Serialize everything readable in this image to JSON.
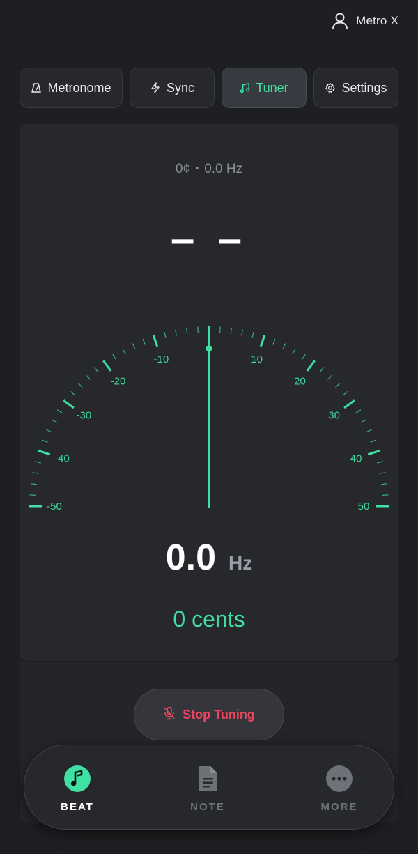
{
  "header": {
    "user_name": "Metro X",
    "user_icon": "person-icon"
  },
  "tabs": [
    {
      "label": "Metronome",
      "icon": "metronome-icon",
      "active": false
    },
    {
      "label": "Sync",
      "icon": "lightning-icon",
      "active": false
    },
    {
      "label": "Tuner",
      "icon": "music-note-icon",
      "active": true
    },
    {
      "label": "Settings",
      "icon": "gear-icon",
      "active": false
    }
  ],
  "tuner": {
    "cents_small": "0¢",
    "separator": "•",
    "hz_small": "0.0 Hz",
    "note": "– –",
    "frequency": "0.0",
    "frequency_unit": "Hz",
    "cents_label": "0 cents",
    "cents_value": 0,
    "gauge": {
      "min": -50,
      "max": 50,
      "labels": [
        "-50",
        "-40",
        "-30",
        "-20",
        "-10",
        "10",
        "20",
        "30",
        "40",
        "50"
      ]
    }
  },
  "stop_button": {
    "label": "Stop Tuning",
    "icon": "mic-off-icon"
  },
  "bottom_nav": [
    {
      "label": "BEAT",
      "icon": "music-note-circle-icon",
      "active": true
    },
    {
      "label": "NOTE",
      "icon": "document-icon",
      "active": false
    },
    {
      "label": "MORE",
      "icon": "more-dots-icon",
      "active": false
    }
  ],
  "colors": {
    "accent": "#3fe0a4",
    "danger": "#f0445e",
    "background": "#1e1f22",
    "panel": "#27282b"
  }
}
